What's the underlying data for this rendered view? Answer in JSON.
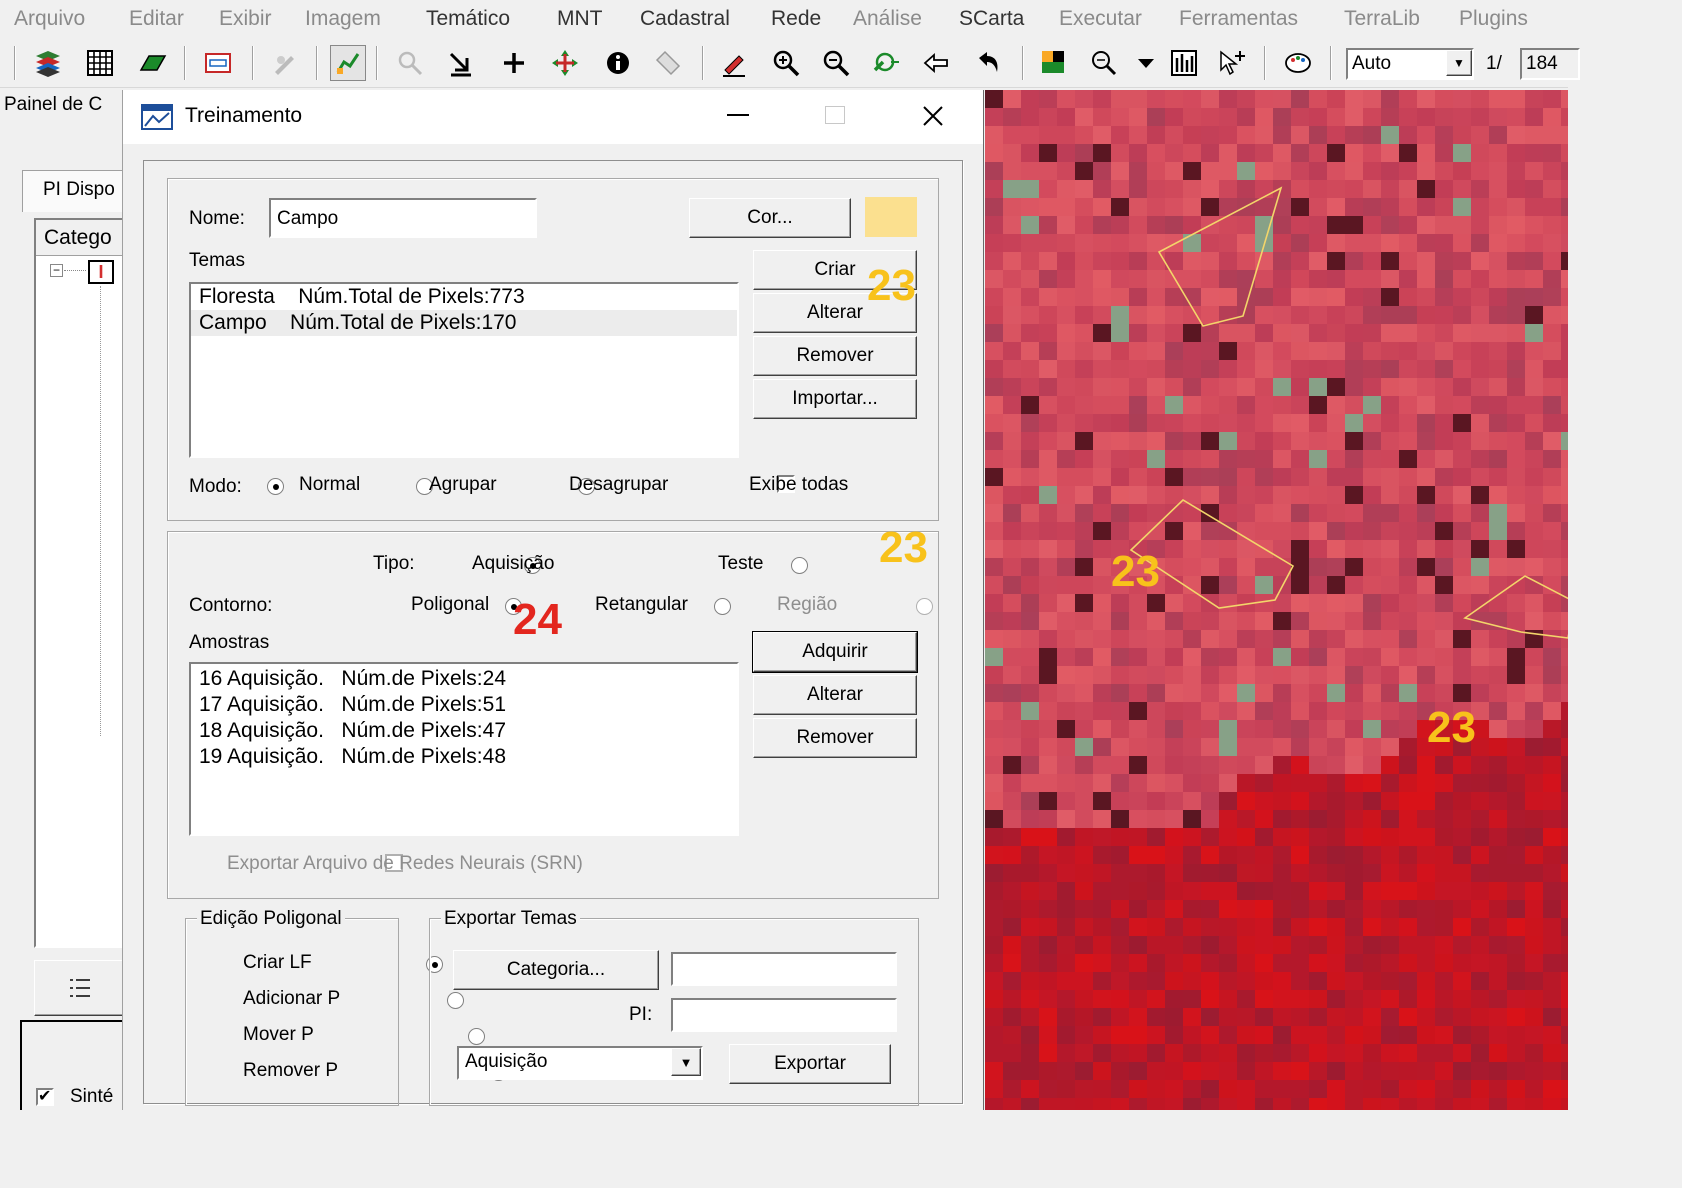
{
  "menubar": [
    "Arquivo",
    "Editar",
    "Exibir",
    "Imagem",
    "Temático",
    "MNT",
    "Cadastral",
    "Rede",
    "Análise",
    "SCarta",
    "Executar",
    "Ferramentas",
    "TerraLib",
    "Plugins"
  ],
  "toolbar": {
    "scale_mode": "Auto",
    "scale_prefix": "1/",
    "scale_value": "184"
  },
  "left_panel": {
    "title": "Painel de C",
    "tab": "PI Dispo",
    "tree_header": "Catego",
    "tree_node_icon_letter": "I",
    "bottom_checkbox_label": "Sinté",
    "bottom_checkbox_checked": true
  },
  "dialog": {
    "title": "Treinamento",
    "nome_label": "Nome:",
    "nome_value": "Campo",
    "cor_button": "Cor...",
    "swatch_color": "#fbe08f",
    "temas_label": "Temas",
    "temas": [
      "Floresta    Núm.Total de Pixels:773",
      "Campo    Núm.Total de Pixels:170"
    ],
    "temas_selected": 1,
    "temas_buttons": {
      "criar": "Criar",
      "alterar": "Alterar",
      "remover": "Remover",
      "importar": "Importar..."
    },
    "modo_label": "Modo:",
    "modo_options": [
      "Normal",
      "Agrupar",
      "Desagrupar"
    ],
    "modo_selected": 0,
    "exibe_todas": "Exibe todas",
    "exibe_todas_checked": false,
    "tipo_label": "Tipo:",
    "tipo_options": [
      "Aquisição",
      "Teste"
    ],
    "tipo_selected": 0,
    "contorno_label": "Contorno:",
    "contorno_options": [
      "Poligonal",
      "Retangular",
      "Região"
    ],
    "contorno_selected": 0,
    "amostras_label": "Amostras",
    "amostras": [
      "16 Aquisição.   Núm.de Pixels:24",
      "17 Aquisição.   Núm.de Pixels:51",
      "18 Aquisição.   Núm.de Pixels:47",
      "19 Aquisição.   Núm.de Pixels:48"
    ],
    "amostras_buttons": {
      "adquirir": "Adquirir",
      "alterar": "Alterar",
      "remover": "Remover"
    },
    "exportar_srn": "Exportar Arquivo de Redes Neurais (SRN)",
    "edicao_title": "Edição Poligonal",
    "edicao_options": [
      "Criar LF",
      "Adicionar P",
      "Mover P",
      "Remover P"
    ],
    "edicao_selected": 0,
    "exportar_title": "Exportar Temas",
    "categoria_button": "Categoria...",
    "categoria_value": "",
    "pi_label": "PI:",
    "pi_value": "",
    "combo_value": "Aquisição",
    "exportar_button": "Exportar"
  },
  "annotations": {
    "criar": "23",
    "panel": "23",
    "map_poly": "23",
    "map_bottom": "23",
    "contorno": "24",
    "color_23": "#f8c21b",
    "color_24": "#e3261e"
  }
}
